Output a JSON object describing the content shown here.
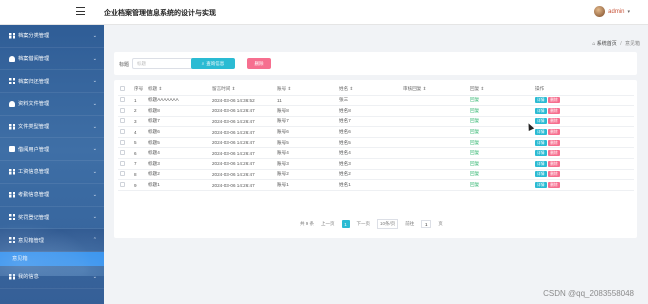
{
  "header": {
    "title": "企业档案管理信息系统的设计与实现",
    "user_name": "admin"
  },
  "sidebar": {
    "items": [
      {
        "label": "档案分类管理",
        "icon": "grid-icon"
      },
      {
        "label": "档案借阅管理",
        "icon": "person-icon"
      },
      {
        "label": "档案归还管理",
        "icon": "grid-icon"
      },
      {
        "label": "资料文件管理",
        "icon": "person-icon"
      },
      {
        "label": "文件类型管理",
        "icon": "grid-icon"
      },
      {
        "label": "借阅用户管理",
        "icon": "doc-icon"
      },
      {
        "label": "工资信息管理",
        "icon": "grid-icon"
      },
      {
        "label": "考勤信息管理",
        "icon": "grid-icon"
      },
      {
        "label": "奖罚登记管理",
        "icon": "grid-icon"
      },
      {
        "label": "意见箱管理",
        "icon": "grid-icon"
      }
    ],
    "submenu_item": "意见箱",
    "last_item": {
      "label": "我的信息",
      "icon": "grid-icon"
    }
  },
  "breadcrumb": {
    "home": "系统首页",
    "separator": "/",
    "current": "意见箱"
  },
  "search": {
    "label": "标题",
    "placeholder": "标题",
    "search_button": "查询信息",
    "delete_button": "删除"
  },
  "table": {
    "columns": [
      "序号",
      "标题 ⇕",
      "留言时间 ⇕",
      "账号 ⇕",
      "姓名 ⇕",
      "审核回复 ⇕",
      "回复 ⇕",
      "操作"
    ],
    "rows": [
      {
        "no": "1",
        "title": "标题AAAAAAA",
        "time": "2024-03-06 14:36:52",
        "account": "11",
        "name": "张三",
        "status": "回复"
      },
      {
        "no": "2",
        "title": "标题8",
        "time": "2024-03-06 14:26:47",
        "account": "账号8",
        "name": "姓名8",
        "status": "回复"
      },
      {
        "no": "3",
        "title": "标题7",
        "time": "2024-03-06 14:26:47",
        "account": "账号7",
        "name": "姓名7",
        "status": "回复"
      },
      {
        "no": "4",
        "title": "标题6",
        "time": "2024-03-06 14:26:47",
        "account": "账号6",
        "name": "姓名6",
        "status": "回复"
      },
      {
        "no": "5",
        "title": "标题5",
        "time": "2024-03-06 14:26:47",
        "account": "账号5",
        "name": "姓名5",
        "status": "回复"
      },
      {
        "no": "6",
        "title": "标题4",
        "time": "2024-03-06 14:26:47",
        "account": "账号4",
        "name": "姓名4",
        "status": "回复"
      },
      {
        "no": "7",
        "title": "标题3",
        "time": "2024-03-06 14:26:47",
        "account": "账号3",
        "name": "姓名3",
        "status": "回复"
      },
      {
        "no": "8",
        "title": "标题2",
        "time": "2024-03-06 14:26:47",
        "account": "账号2",
        "name": "姓名2",
        "status": "回复"
      },
      {
        "no": "9",
        "title": "标题1",
        "time": "2024-03-06 14:26:47",
        "account": "账号1",
        "name": "姓名1",
        "status": "回复"
      }
    ],
    "detail_label": "详情",
    "delete_label": "删除"
  },
  "pagination": {
    "total": "共 9 条",
    "prev": "上一页",
    "current_page": "1",
    "next": "下一页",
    "page_size": "10条/页",
    "goto_label": "前往",
    "goto_value": "1",
    "page_suffix": "页"
  },
  "watermark": "CSDN @qq_2083558048",
  "colors": {
    "accent": "#2bbbd3",
    "danger": "#f66f8f",
    "sidebar": "#3a6aa2",
    "submenu_active": "#2f8ff0"
  }
}
